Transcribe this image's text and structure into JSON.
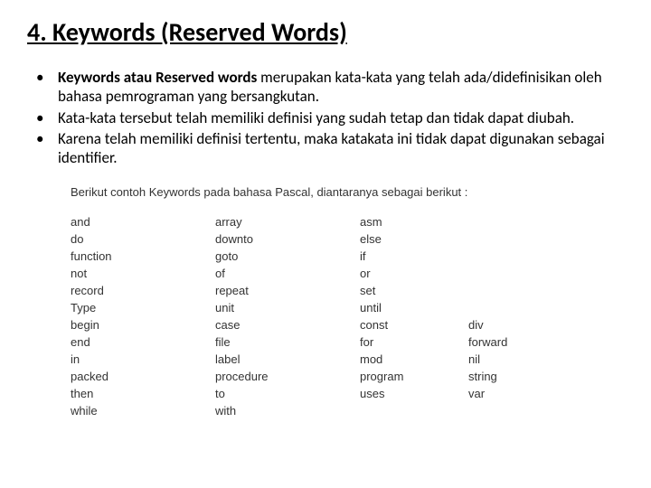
{
  "title": "4. Keywords (Reserved Words)",
  "bullets": [
    {
      "bold": "Keywords atau Reserved words",
      "rest": " merupakan kata-kata yang telah ada/didefinisikan oleh bahasa pemrograman yang bersangkutan."
    },
    {
      "bold": "",
      "rest": "Kata-kata tersebut telah memiliki definisi yang sudah tetap dan tidak dapat diubah."
    },
    {
      "bold": "",
      "rest": "Karena telah memiliki definisi tertentu, maka katakata ini tidak dapat digunakan sebagai identifier."
    }
  ],
  "intro": "Berikut contoh Keywords pada bahasa Pascal, diantaranya sebagai berikut :",
  "keywords": [
    [
      "and",
      "array",
      "asm",
      ""
    ],
    [
      "do",
      "downto",
      "else",
      ""
    ],
    [
      "function",
      "goto",
      "if",
      ""
    ],
    [
      "not",
      "of",
      "or",
      ""
    ],
    [
      "record",
      "repeat",
      "set",
      ""
    ],
    [
      "Type",
      "unit",
      "until",
      ""
    ],
    [
      "begin",
      "case",
      "const",
      "div"
    ],
    [
      "end",
      "file",
      "for",
      "forward"
    ],
    [
      "in",
      "label",
      "mod",
      "nil"
    ],
    [
      "packed",
      "procedure",
      "program",
      "string"
    ],
    [
      "then",
      "to",
      "uses",
      "var"
    ],
    [
      "while",
      "with",
      "",
      ""
    ]
  ]
}
